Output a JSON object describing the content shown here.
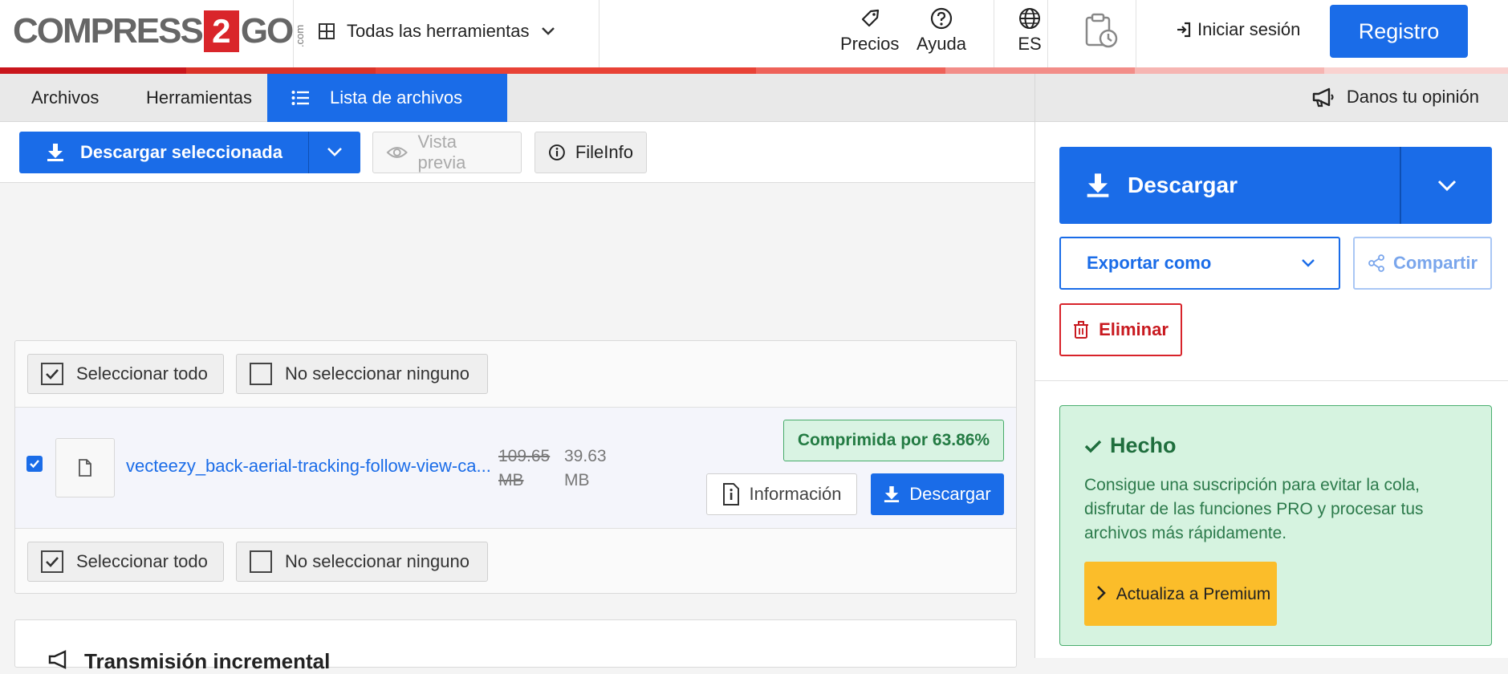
{
  "header": {
    "logo": {
      "left": "COMPRESS",
      "mid": "2",
      "right": "GO",
      "suffix": ".com"
    },
    "tools_menu_label": "Todas las herramientas",
    "pricing_label": "Precios",
    "help_label": "Ayuda",
    "language_label": "ES",
    "login_label": "Iniciar sesión",
    "register_label": "Registro"
  },
  "tabs": [
    {
      "label": "Archivos"
    },
    {
      "label": "Herramientas"
    },
    {
      "label": "Lista de archivos"
    }
  ],
  "feedback_label": "Danos tu opinión",
  "toolbar": {
    "download_selected_label": "Descargar seleccionada",
    "preview_label": "Vista previa",
    "fileinfo_label": "FileInfo"
  },
  "file_list": {
    "select_all_label": "Seleccionar todo",
    "select_none_label": "No seleccionar ninguno",
    "file": {
      "name": "vecteezy_back-aerial-tracking-follow-view-ca...",
      "original_size_value": "109.65",
      "original_size_unit": "MB",
      "new_size_value": "39.63",
      "new_size_unit": "MB",
      "compressed_label": "Comprimida por 63.86%",
      "info_label": "Información",
      "download_label": "Descargar"
    }
  },
  "bottom_panel_title": "Transmisión incremental",
  "sidebar": {
    "download_label": "Descargar",
    "export_label": "Exportar como",
    "share_label": "Compartir",
    "delete_label": "Eliminar",
    "done_title": "Hecho",
    "done_message": "Consigue una suscripción para evitar la cola, disfrutar de las funciones PRO y procesar tus archivos más rápidamente.",
    "premium_label": "Actualiza a Premium"
  },
  "colors": {
    "primary": "#1a6ce8",
    "danger": "#d8232a",
    "success_bg": "#d6f3e0",
    "premium": "#fbbd2a"
  }
}
